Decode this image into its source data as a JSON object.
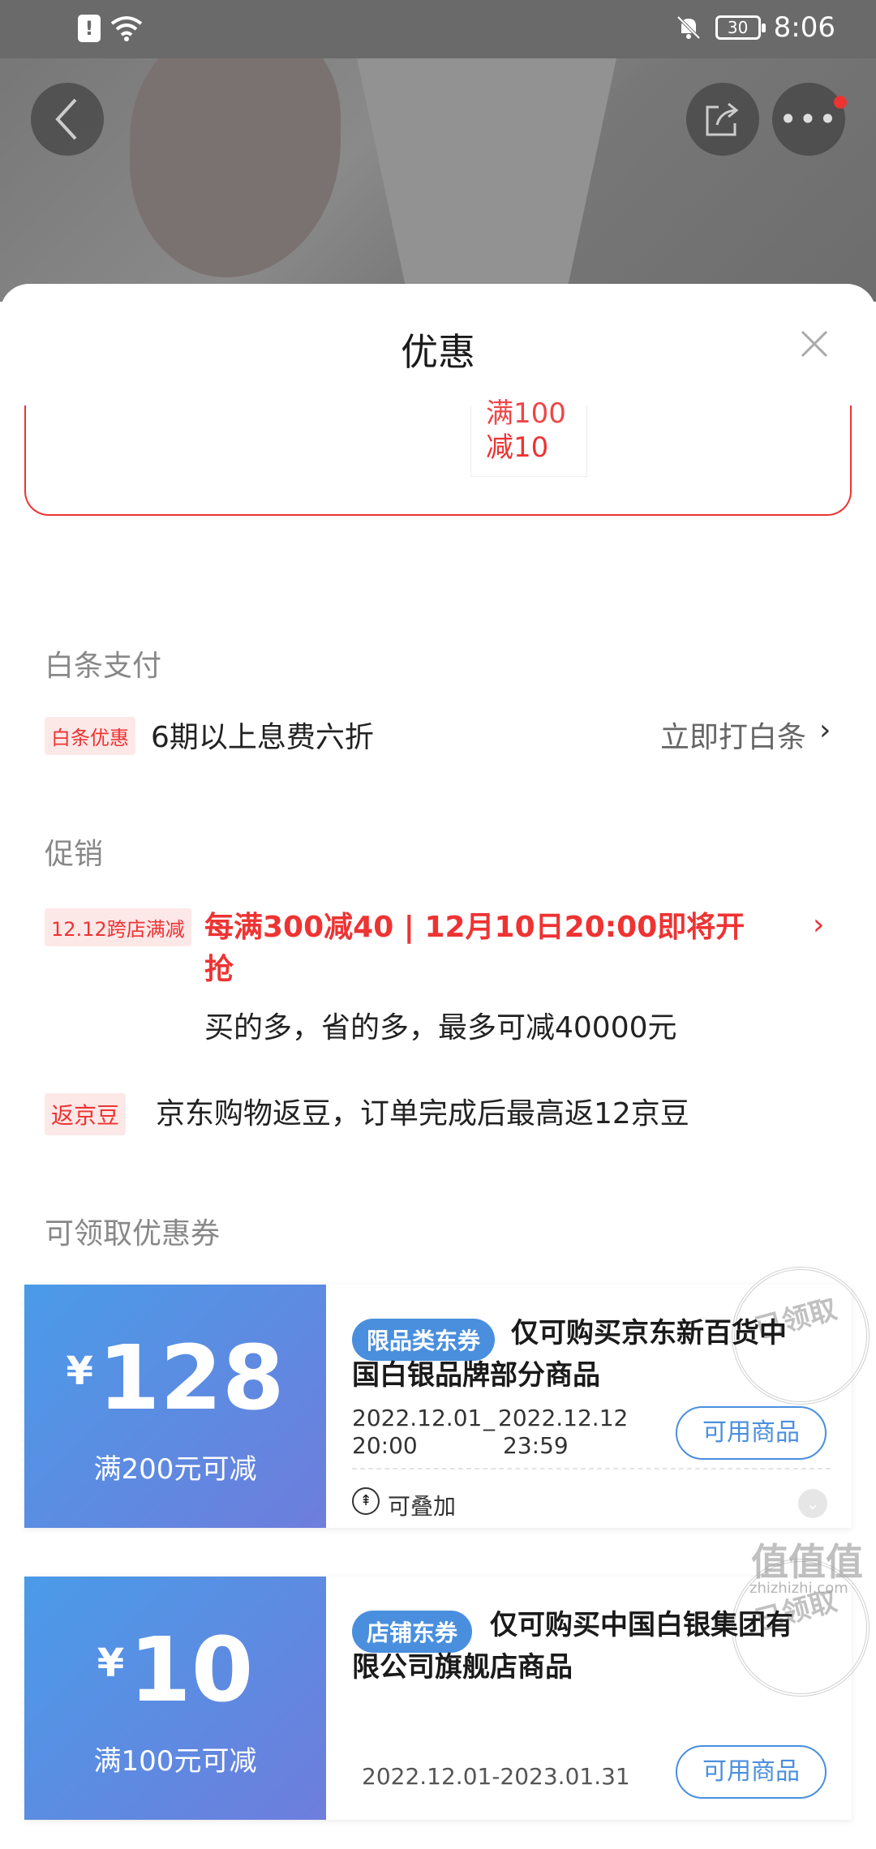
{
  "status_bar": {
    "time": "8:06",
    "battery": "30"
  },
  "sheet": {
    "title": "优惠"
  },
  "top_chip": {
    "line1": "满100",
    "line2": "减10"
  },
  "baitiao": {
    "section": "白条支付",
    "tag": "白条优惠",
    "text": "6期以上息费六折",
    "link": "立即打白条"
  },
  "promo": {
    "section": "促销",
    "item1": {
      "tag": "12.12跨店满减",
      "title": "每满300减40 | 12月10日20:00即将开抢",
      "sub": "买的多，省的多，最多可减40000元"
    },
    "item2": {
      "tag": "返京豆",
      "text": "京东购物返豆，订单完成后最高返12京豆"
    }
  },
  "coupons_section": "可领取优惠券",
  "coupons": [
    {
      "yen": "¥",
      "amount": "128",
      "condition": "满200元可减",
      "badge": "限品类东券",
      "title": "仅可购买京东新百货中国白银品牌部分商品",
      "date_start": "2022.12.01",
      "date_sep": "_",
      "date_end": "2022.12.12",
      "time_start": "20:00",
      "time_end": "23:59",
      "button": "可用商品",
      "stamp": "已领取",
      "stackable": "可叠加"
    },
    {
      "yen": "¥",
      "amount": "10",
      "condition": "满100元可减",
      "badge": "店铺东券",
      "title": "仅可购买中国白银集团有限公司旗舰店商品",
      "date_range": "2022.12.01-2023.01.31",
      "button": "可用商品",
      "stamp": "已领取"
    }
  ],
  "watermark": "值值值",
  "watermark_sub": "zhizhizhi.com",
  "colors": {
    "accent_red": "#e33333",
    "coupon_blue": "#4a8fde"
  }
}
